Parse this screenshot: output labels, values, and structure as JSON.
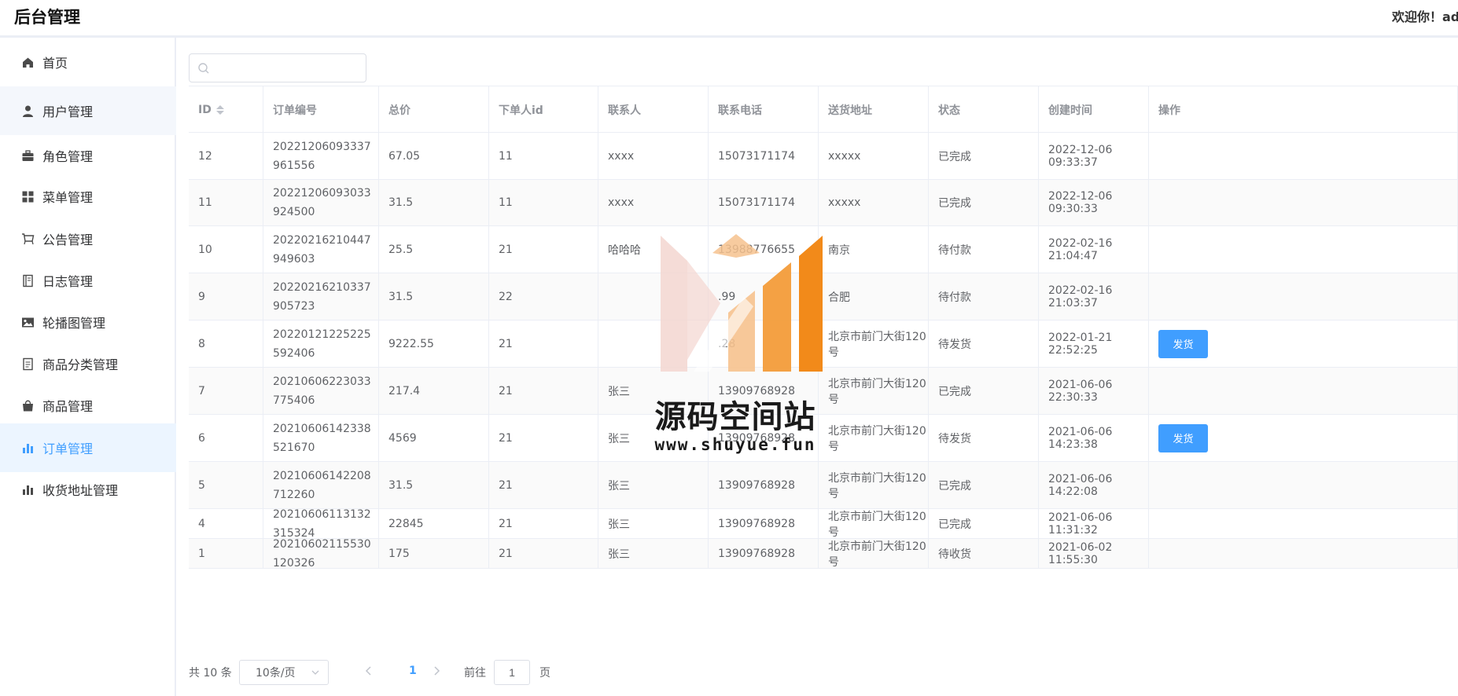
{
  "header": {
    "title": "后台管理",
    "welcome": "欢迎你！admin"
  },
  "sidebar": {
    "items": [
      {
        "label": "首页",
        "icon": "home-icon"
      },
      {
        "label": "用户管理",
        "icon": "user-icon"
      },
      {
        "label": "角色管理",
        "icon": "briefcase-icon"
      },
      {
        "label": "菜单管理",
        "icon": "grid-icon"
      },
      {
        "label": "公告管理",
        "icon": "cart-icon"
      },
      {
        "label": "日志管理",
        "icon": "notebook-icon"
      },
      {
        "label": "轮播图管理",
        "icon": "picture-icon"
      },
      {
        "label": "商品分类管理",
        "icon": "document-icon"
      },
      {
        "label": "商品管理",
        "icon": "bag-icon"
      },
      {
        "label": "订单管理",
        "icon": "chart-icon"
      },
      {
        "label": "收货地址管理",
        "icon": "chart-icon"
      }
    ],
    "active_index": 9
  },
  "search": {
    "value": "",
    "placeholder": ""
  },
  "table": {
    "columns": [
      "ID",
      "订单编号",
      "总价",
      "下单人id",
      "联系人",
      "联系电话",
      "送货地址",
      "状态",
      "创建时间",
      "操作"
    ],
    "rows": [
      {
        "id": "12",
        "order_no": "20221206093337961556",
        "total": "67.05",
        "user_id": "11",
        "contact": "xxxx",
        "phone": "15073171174",
        "address": "xxxxx",
        "status": "已完成",
        "created": "2022-12-06 09:33:37",
        "action": ""
      },
      {
        "id": "11",
        "order_no": "20221206093033924500",
        "total": "31.5",
        "user_id": "11",
        "contact": "xxxx",
        "phone": "15073171174",
        "address": "xxxxx",
        "status": "已完成",
        "created": "2022-12-06 09:30:33",
        "action": ""
      },
      {
        "id": "10",
        "order_no": "20220216210447949603",
        "total": "25.5",
        "user_id": "21",
        "contact": "哈哈哈",
        "phone": "13988776655",
        "address": "南京",
        "status": "待付款",
        "created": "2022-02-16 21:04:47",
        "action": ""
      },
      {
        "id": "9",
        "order_no": "20220216210337905723",
        "total": "31.5",
        "user_id": "22",
        "contact": "",
        "phone": ".99",
        "address": "合肥",
        "status": "待付款",
        "created": "2022-02-16 21:03:37",
        "action": ""
      },
      {
        "id": "8",
        "order_no": "20220121225225592406",
        "total": "9222.55",
        "user_id": "21",
        "contact": "",
        "phone": ".28",
        "address": "北京市前门大街120号",
        "status": "待发货",
        "created": "2022-01-21 22:52:25",
        "action": "发货"
      },
      {
        "id": "7",
        "order_no": "20210606223033775406",
        "total": "217.4",
        "user_id": "21",
        "contact": "张三",
        "phone": "13909768928",
        "address": "北京市前门大街120号",
        "status": "已完成",
        "created": "2021-06-06 22:30:33",
        "action": ""
      },
      {
        "id": "6",
        "order_no": "20210606142338521670",
        "total": "4569",
        "user_id": "21",
        "contact": "张三",
        "phone": "13909768928",
        "address": "北京市前门大街120号",
        "status": "待发货",
        "created": "2021-06-06 14:23:38",
        "action": "发货"
      },
      {
        "id": "5",
        "order_no": "20210606142208712260",
        "total": "31.5",
        "user_id": "21",
        "contact": "张三",
        "phone": "13909768928",
        "address": "北京市前门大街120号",
        "status": "已完成",
        "created": "2021-06-06 14:22:08",
        "action": ""
      },
      {
        "id": "4",
        "order_no": "20210606113132315324",
        "total": "22845",
        "user_id": "21",
        "contact": "张三",
        "phone": "13909768928",
        "address": "北京市前门大街120号",
        "status": "已完成",
        "created": "2021-06-06 11:31:32",
        "action": ""
      },
      {
        "id": "1",
        "order_no": "20210602115530120326",
        "total": "175",
        "user_id": "21",
        "contact": "张三",
        "phone": "13909768928",
        "address": "北京市前门大街120号",
        "status": "待收货",
        "created": "2021-06-02 11:55:30",
        "action": ""
      }
    ]
  },
  "pagination": {
    "total_text": "共 10 条",
    "page_size": "10条/页",
    "current_page": "1",
    "goto_label": "前往",
    "goto_value": "1",
    "page_suffix": "页"
  },
  "watermark": {
    "text": "源码空间站",
    "url": "www.shuyue.fun"
  },
  "colors": {
    "accent": "#409eff",
    "logo_orange": "#f28a1a",
    "logo_light": "#f6c28e",
    "logo_pink": "#f3d6d0"
  }
}
